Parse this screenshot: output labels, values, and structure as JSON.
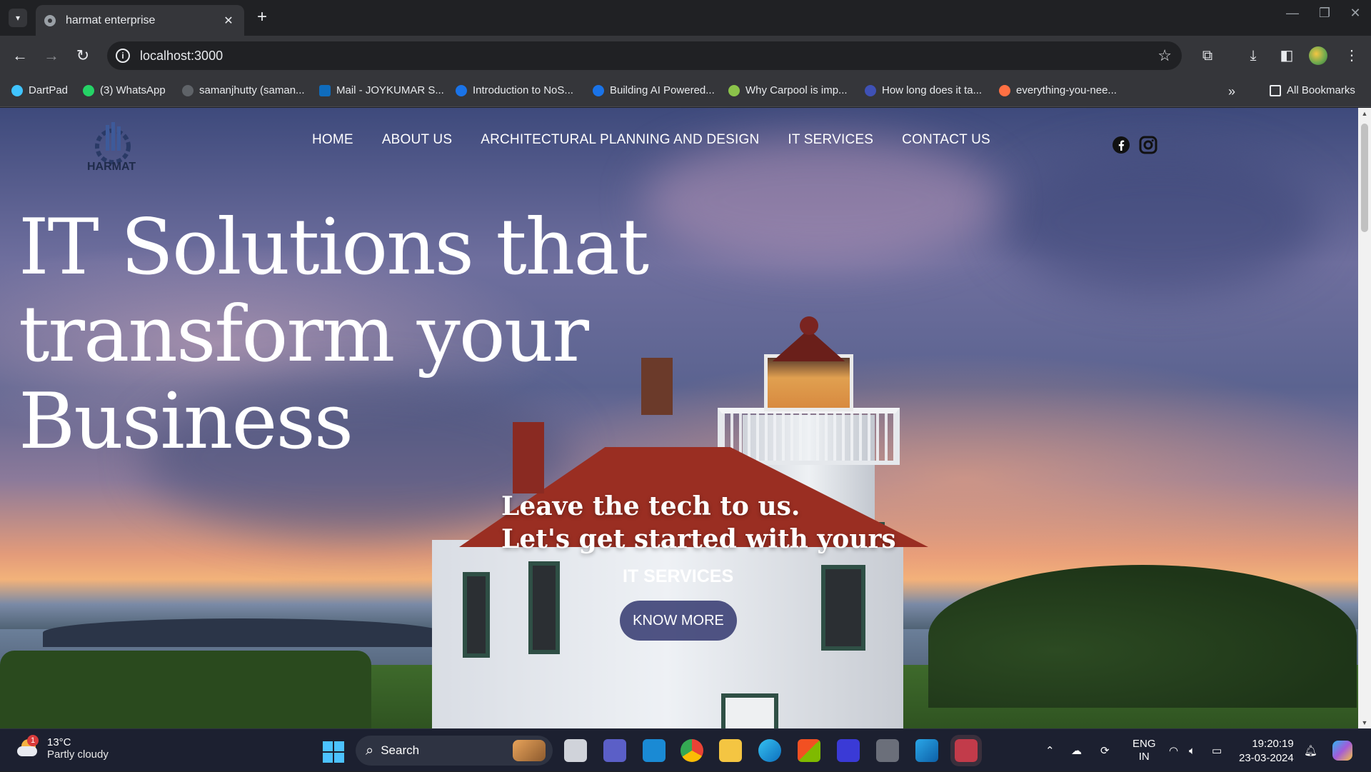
{
  "browser": {
    "tab_title": "harmat enterprise",
    "tab_close": "✕",
    "new_tab": "+",
    "url": "localhost:3000",
    "bookmarks": [
      {
        "label": "DartPad",
        "color": "#40c4ff"
      },
      {
        "label": "(3) WhatsApp",
        "color": "#25d366"
      },
      {
        "label": "samanjhutty (saman...",
        "color": "#9aa0a6"
      },
      {
        "label": "Mail - JOYKUMAR S...",
        "color": "#0f6cbd"
      },
      {
        "label": "Introduction to NoS...",
        "color": "#1a73e8"
      },
      {
        "label": "Building AI Powered...",
        "color": "#1a73e8"
      },
      {
        "label": "Why Carpool is imp...",
        "color": "#8bc34a"
      },
      {
        "label": "How long does it ta...",
        "color": "#3f51b5"
      },
      {
        "label": "everything-you-nee...",
        "color": "#ff7043"
      }
    ],
    "all_bookmarks": "All Bookmarks",
    "overflow": "»"
  },
  "site": {
    "logo_text": "HARMAT",
    "nav": [
      "HOME",
      "ABOUT US",
      "ARCHITECTURAL PLANNING AND DESIGN",
      "IT SERVICES",
      "CONTACT US"
    ],
    "social": [
      "facebook-icon",
      "instagram-icon"
    ],
    "headline": "IT Solutions that transform your Business",
    "tagline_line1": "Leave the tech to us.",
    "tagline_line2": "Let's get started with yours",
    "section_label": "IT SERVICES",
    "cta": "KNOW MORE"
  },
  "taskbar": {
    "weather_badge": "1",
    "temperature": "13°C",
    "weather": "Partly cloudy",
    "search": "Search",
    "language": "ENG",
    "region": "IN",
    "time": "19:20:19",
    "date": "23-03-2024"
  },
  "colors": {
    "accent_taskbar": "#4cc2ff",
    "cta_bg": "#32376e"
  }
}
